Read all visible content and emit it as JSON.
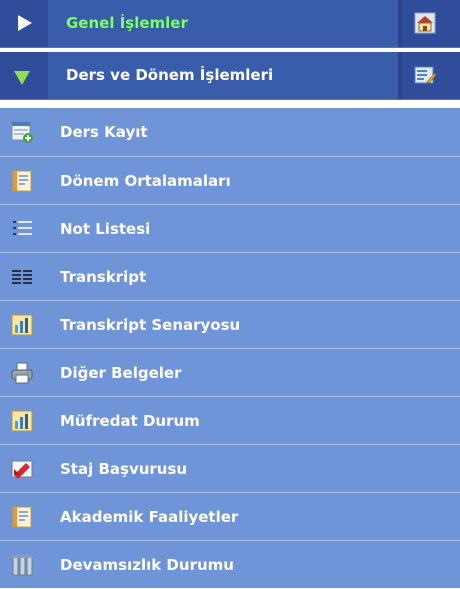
{
  "menu": {
    "sections": [
      {
        "label": "Genel İşlemler",
        "expanded": false,
        "icon": "home-icon"
      },
      {
        "label": "Ders ve Dönem İşlemleri",
        "expanded": true,
        "icon": "edit-icon"
      }
    ],
    "items": [
      {
        "label": "Ders Kayıt",
        "icon": "course-register-icon"
      },
      {
        "label": "Dönem Ortalamaları",
        "icon": "document-icon"
      },
      {
        "label": "Not Listesi",
        "icon": "list-icon"
      },
      {
        "label": "Transkript",
        "icon": "transcript-icon"
      },
      {
        "label": "Transkript Senaryosu",
        "icon": "chart-icon"
      },
      {
        "label": "Diğer Belgeler",
        "icon": "printer-icon"
      },
      {
        "label": "Müfredat Durum",
        "icon": "chart-icon"
      },
      {
        "label": "Staj Başvurusu",
        "icon": "internship-icon"
      },
      {
        "label": "Akademik Faaliyetler",
        "icon": "document-icon"
      },
      {
        "label": "Devamsızlık Durumu",
        "icon": "attendance-icon"
      }
    ]
  },
  "colors": {
    "header_bg": "#2f4d9a",
    "item_bg": "#6f95d8",
    "collapsed_label": "#7dff62",
    "expanded_arrow": "#8ce04a"
  }
}
